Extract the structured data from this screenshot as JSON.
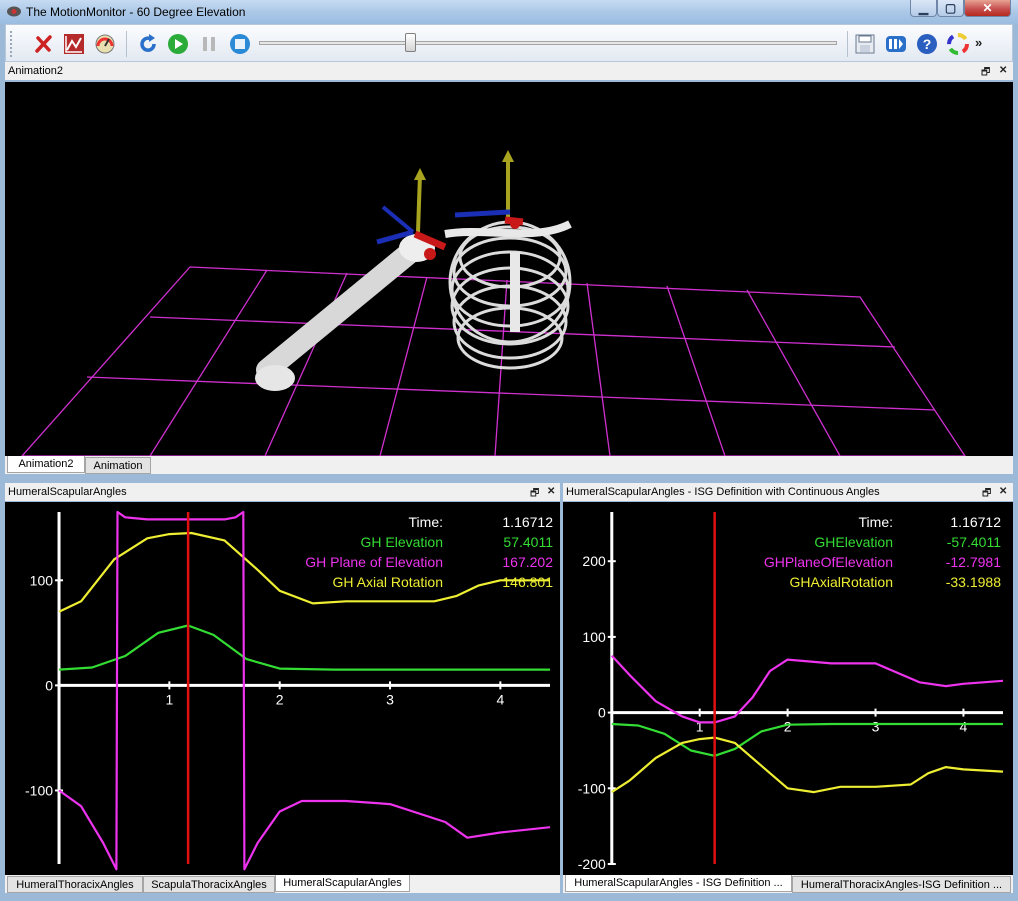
{
  "window": {
    "title": "The MotionMonitor - 60 Degree Elevation"
  },
  "toolbar": {
    "icons": [
      "stop-x-icon",
      "chart-icon",
      "gauge-icon",
      "refresh-icon",
      "play-icon",
      "pause-icon",
      "stop-icon",
      "save-icon",
      "toggle-icon",
      "help-icon",
      "color-wheel-icon"
    ],
    "overflow": "»"
  },
  "animation_panel": {
    "title": "Animation2",
    "tabs": [
      "Animation2",
      "Animation"
    ],
    "active_tab": 0
  },
  "left_panel": {
    "title": "HumeralScapularAngles",
    "tabs": [
      "HumeralThoracixAngles",
      "ScapulaThoracixAngles",
      "HumeralScapularAngles"
    ],
    "active_tab": 2,
    "readouts": [
      {
        "label": "Time:",
        "value": "1.16712",
        "color": "#ffffff"
      },
      {
        "label": "GH Elevation",
        "value": "57.4011",
        "color": "#33dd33"
      },
      {
        "label": "GH Plane of Elevation",
        "value": "167.202",
        "color": "#ee33ee"
      },
      {
        "label": "GH Axial Rotation",
        "value": "146.801",
        "color": "#eeee33"
      }
    ]
  },
  "right_panel": {
    "title": "HumeralScapularAngles - ISG Definition with Continuous Angles",
    "tabs": [
      "HumeralScapularAngles - ISG Definition ...",
      "HumeralThoracixAngles-ISG Definition ..."
    ],
    "active_tab": 0,
    "readouts": [
      {
        "label": "Time:",
        "value": "1.16712",
        "color": "#ffffff"
      },
      {
        "label": "GHElevation",
        "value": "-57.4011",
        "color": "#33dd33"
      },
      {
        "label": "GHPlaneOfElevation",
        "value": "-12.7981",
        "color": "#ee33ee"
      },
      {
        "label": "GHAxialRotation",
        "value": "-33.1988",
        "color": "#eeee33"
      }
    ]
  },
  "chart_data": [
    {
      "type": "line",
      "title": "",
      "xlabel": "",
      "ylabel": "",
      "xlim": [
        -0.1,
        4.45
      ],
      "ylim": [
        -170,
        165
      ],
      "x_ticks": [
        1,
        2,
        3,
        4
      ],
      "y_ticks": [
        100,
        0,
        -100
      ],
      "cursor_x": 1.17,
      "series": [
        {
          "name": "GH Elevation",
          "color": "#33dd33",
          "x": [
            0,
            0.3,
            0.6,
            0.9,
            1.17,
            1.4,
            1.7,
            2.0,
            2.5,
            3.0,
            3.5,
            4.0,
            4.45
          ],
          "y": [
            15,
            17,
            28,
            50,
            57,
            48,
            25,
            16,
            15,
            15,
            15,
            15,
            15
          ]
        },
        {
          "name": "GH Axial Rotation",
          "color": "#eeee33",
          "x": [
            0,
            0.2,
            0.5,
            0.8,
            1.0,
            1.2,
            1.5,
            1.8,
            2.0,
            2.3,
            2.6,
            3.0,
            3.4,
            3.6,
            3.8,
            4.0,
            4.45
          ],
          "y": [
            70,
            80,
            120,
            140,
            144,
            145,
            138,
            110,
            90,
            78,
            80,
            80,
            80,
            85,
            95,
            100,
            100
          ]
        },
        {
          "name": "GH Plane of Elevation",
          "color": "#ee33ee",
          "x": [
            0,
            0.2,
            0.4,
            0.52,
            0.53,
            0.6,
            0.8,
            1.17,
            1.5,
            1.6,
            1.67,
            1.68,
            1.8,
            2.0,
            2.2,
            2.6,
            3.0,
            3.5,
            3.7,
            4.0,
            4.45
          ],
          "y": [
            -100,
            -115,
            -150,
            -175,
            165,
            160,
            158,
            158,
            158,
            160,
            165,
            -175,
            -150,
            -120,
            -110,
            -110,
            -113,
            -130,
            -145,
            -140,
            -135
          ]
        }
      ]
    },
    {
      "type": "line",
      "title": "",
      "xlabel": "",
      "ylabel": "",
      "xlim": [
        -0.1,
        4.45
      ],
      "ylim": [
        -200,
        265
      ],
      "x_ticks": [
        1,
        2,
        3,
        4
      ],
      "y_ticks": [
        200,
        100,
        0,
        -100,
        -200
      ],
      "cursor_x": 1.17,
      "series": [
        {
          "name": "GHElevation",
          "color": "#33dd33",
          "x": [
            0,
            0.3,
            0.6,
            0.9,
            1.17,
            1.4,
            1.7,
            2.0,
            2.5,
            3.0,
            3.5,
            4.0,
            4.45
          ],
          "y": [
            -15,
            -17,
            -28,
            -50,
            -57,
            -48,
            -25,
            -16,
            -15,
            -15,
            -15,
            -15,
            -15
          ]
        },
        {
          "name": "GHPlaneOfElevation",
          "color": "#ee33ee",
          "x": [
            0,
            0.2,
            0.5,
            0.8,
            1.0,
            1.17,
            1.4,
            1.6,
            1.8,
            2.0,
            2.5,
            3.0,
            3.5,
            3.8,
            4.0,
            4.45
          ],
          "y": [
            75,
            50,
            15,
            -5,
            -13,
            -13,
            -5,
            20,
            55,
            70,
            65,
            65,
            40,
            35,
            38,
            42
          ]
        },
        {
          "name": "GHAxialRotation",
          "color": "#eeee33",
          "x": [
            0,
            0.2,
            0.5,
            0.8,
            1.0,
            1.17,
            1.4,
            1.7,
            2.0,
            2.3,
            2.6,
            3.0,
            3.4,
            3.6,
            3.8,
            4.0,
            4.45
          ],
          "y": [
            -105,
            -90,
            -60,
            -40,
            -35,
            -33,
            -40,
            -70,
            -100,
            -105,
            -98,
            -98,
            -95,
            -80,
            -72,
            -75,
            -78
          ]
        }
      ]
    }
  ]
}
